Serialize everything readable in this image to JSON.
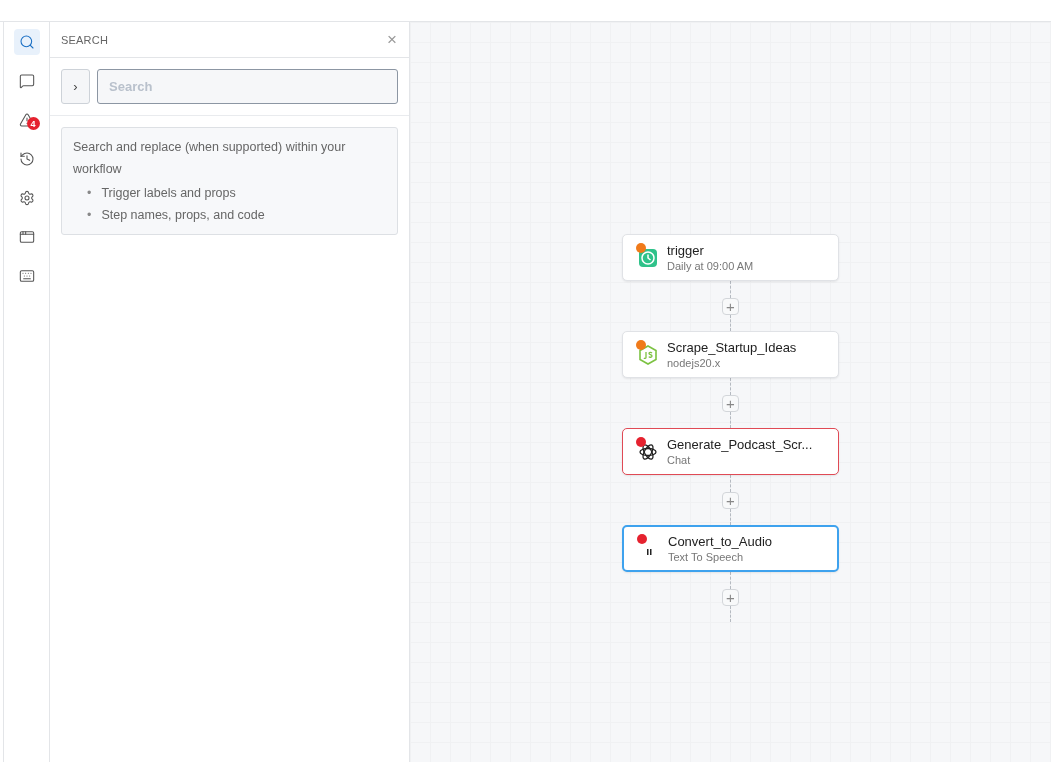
{
  "rail": [
    {
      "selected": true
    },
    {
      "selected": false
    },
    {
      "selected": false,
      "badge": "4"
    },
    {
      "selected": false
    },
    {
      "selected": false
    },
    {
      "selected": false
    },
    {
      "selected": false
    }
  ],
  "panel": {
    "title": "SEARCH",
    "expand_label": "›",
    "close_label": "×",
    "search": {
      "placeholder": "Search"
    },
    "info": {
      "text": "Search and replace (when supported) within your workflow",
      "bullet_mark": "•",
      "bullets": [
        "Trigger labels and props",
        "Step names, props, and code"
      ]
    }
  },
  "steps": [
    {
      "name": "trigger",
      "subtitle": "Daily at 09:00 AM",
      "kind": "clock",
      "color": "#f07a1a",
      "error": false,
      "selected": false
    },
    {
      "name": "Scrape_Startup_Ideas",
      "subtitle": "nodejs20.x",
      "kind": "nodejs",
      "color": "#f07a1a",
      "error": false,
      "selected": false
    },
    {
      "name": "Generate_Podcast_Scr...",
      "subtitle": "Chat",
      "kind": "openai",
      "color": "#e5222f",
      "error": true,
      "selected": false
    },
    {
      "name": "Convert_to_Audio",
      "subtitle": "Text To Speech",
      "kind": "audio",
      "color": "#e5222f",
      "error": false,
      "selected": true
    }
  ],
  "add_label": "+"
}
